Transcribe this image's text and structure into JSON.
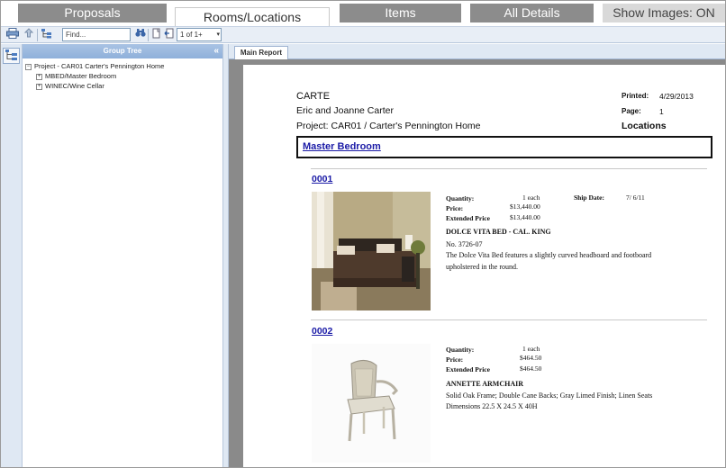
{
  "tabs": {
    "proposals": "Proposals",
    "rooms": "Rooms/Locations",
    "items": "Items",
    "all_details": "All Details",
    "show_images": "Show Images: ON"
  },
  "toolbar": {
    "find_placeholder": "Find...",
    "page_value": "1 of 1+",
    "icons": [
      "print-icon",
      "export-icon",
      "group-tree-toggle-icon",
      "search-binoculars-icon",
      "first-page-icon",
      "previous-page-icon",
      "page-dropdown-arrow-icon"
    ]
  },
  "group_tree": {
    "title": "Group Tree",
    "collapse_symbol": "«",
    "root": {
      "label": "Project - CAR01 Carter's Pennington Home",
      "toggle": "−"
    },
    "children": [
      {
        "label": "MBED/Master Bedroom",
        "toggle": "+"
      },
      {
        "label": "WINEC/Wine Cellar",
        "toggle": "+"
      }
    ]
  },
  "report": {
    "tab": "Main Report",
    "company": "CARTE",
    "client": "Eric and Joanne Carter",
    "project": "Project: CAR01 / Carter's Pennington Home",
    "printed_label": "Printed:",
    "printed_value": "4/29/2013",
    "page_label": "Page:",
    "page_value": "1",
    "section_title": "Locations",
    "room": "Master Bedroom",
    "items": [
      {
        "number": "0001",
        "quantity_label": "Quantity:",
        "quantity_value": "1 each",
        "price_label": "Price:",
        "price_value": "$13,440.00",
        "extended_label": "Extended Price",
        "extended_value": "$13,440.00",
        "ship_label": "Ship Date:",
        "ship_value": "7/ 6/11",
        "name": "DOLCE VITA BED - CAL. KING",
        "line2": "No. 3726-07",
        "desc1": "The Dolce Vita Bed features a slightly curved headboard and footboard",
        "desc2": "upholstered in the round."
      },
      {
        "number": "0002",
        "quantity_label": "Quantity:",
        "quantity_value": "1 each",
        "price_label": "Price:",
        "price_value": "$464.50",
        "extended_label": "Extended Price",
        "extended_value": "$464.50",
        "name": "ANNETTE ARMCHAIR",
        "line2": "Solid Oak Frame; Double Cane Backs; Gray Limed Finish; Linen Seats",
        "desc1": "Dimensions 22.5 X 24.5 X 40H"
      }
    ]
  }
}
